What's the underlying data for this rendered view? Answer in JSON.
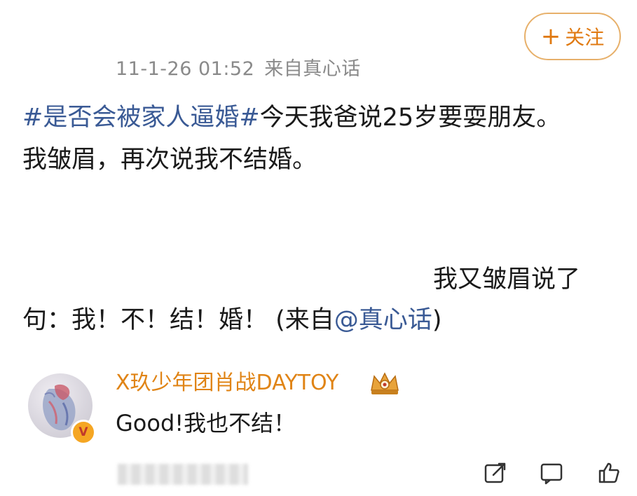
{
  "post": {
    "timestamp": "11-1-26 01:52",
    "source": "来自真心话",
    "follow_label": "关注",
    "follow_plus": "+",
    "hashtag": "#是否会被家人逼婚#",
    "line1_rest": "今天我爸说25岁要耍朋友。",
    "line2": "我皱眉，再次说我不结婚。",
    "line3": "我又皱眉说了",
    "line4_text": "句：我！不！结！婚！ (来自",
    "mention": "@真心话",
    "line4_tail": ")"
  },
  "comment": {
    "username": "X玖少年团肖战DAYTOY",
    "text": "Good!我也不结！",
    "verify_badge": "V"
  },
  "icons": {
    "avatar": "avatar-image",
    "verify": "verified-v-icon",
    "crown": "crown-badge-icon",
    "share": "share-icon",
    "comment": "comment-icon",
    "like": "like-icon"
  },
  "colors": {
    "accent_orange": "#e07a12",
    "link_blue": "#3a5a95",
    "meta_gray": "#8a8a8a"
  }
}
